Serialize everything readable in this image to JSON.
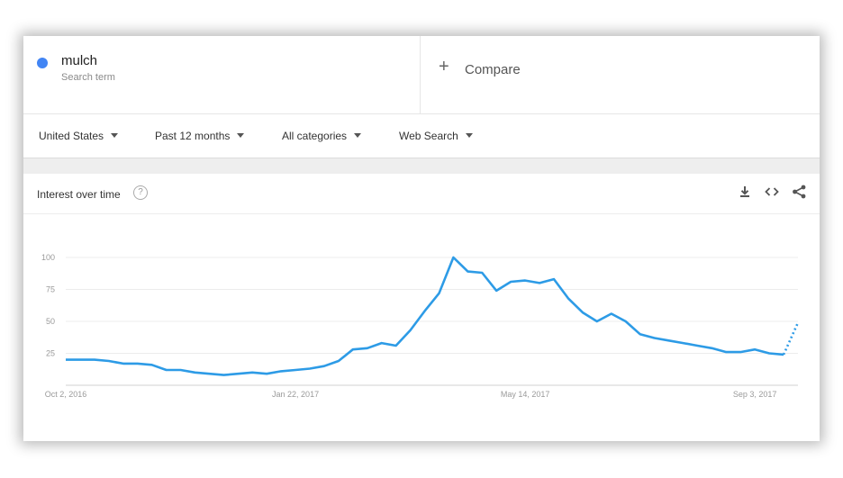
{
  "search_term": {
    "name": "mulch",
    "sublabel": "Search term",
    "color": "#4285f4"
  },
  "compare": {
    "label": "Compare"
  },
  "filters": [
    {
      "label": "United States"
    },
    {
      "label": "Past 12 months"
    },
    {
      "label": "All categories"
    },
    {
      "label": "Web Search"
    }
  ],
  "interest_panel": {
    "title": "Interest over time",
    "icons": [
      "download-icon",
      "embed-icon",
      "share-icon"
    ]
  },
  "chart_data": {
    "type": "line",
    "title": "",
    "xlabel": "",
    "ylabel": "",
    "ylim": [
      0,
      100
    ],
    "yticks": [
      "100",
      "75",
      "50",
      "25"
    ],
    "xticks": [
      "Oct 2, 2016",
      "Jan 22, 2017",
      "May 14, 2017",
      "Sep 3, 2017"
    ],
    "x": [
      "2016-10-02",
      "2016-10-09",
      "2016-10-16",
      "2016-10-23",
      "2016-10-30",
      "2016-11-06",
      "2016-11-13",
      "2016-11-20",
      "2016-11-27",
      "2016-12-04",
      "2016-12-11",
      "2016-12-18",
      "2016-12-25",
      "2017-01-01",
      "2017-01-08",
      "2017-01-15",
      "2017-01-22",
      "2017-01-29",
      "2017-02-05",
      "2017-02-12",
      "2017-02-19",
      "2017-02-26",
      "2017-03-05",
      "2017-03-12",
      "2017-03-19",
      "2017-03-26",
      "2017-04-02",
      "2017-04-09",
      "2017-04-16",
      "2017-04-23",
      "2017-04-30",
      "2017-05-07",
      "2017-05-14",
      "2017-05-21",
      "2017-05-28",
      "2017-06-04",
      "2017-06-11",
      "2017-06-18",
      "2017-06-25",
      "2017-07-02",
      "2017-07-09",
      "2017-07-16",
      "2017-07-23",
      "2017-07-30",
      "2017-08-06",
      "2017-08-13",
      "2017-08-20",
      "2017-08-27",
      "2017-09-03",
      "2017-09-10",
      "2017-09-17",
      "2017-09-24"
    ],
    "series": [
      {
        "color": "#2d9be6",
        "values": [
          20,
          20,
          20,
          19,
          17,
          17,
          16,
          12,
          12,
          10,
          9,
          8,
          9,
          10,
          9,
          11,
          12,
          13,
          15,
          19,
          28,
          29,
          33,
          31,
          43,
          58,
          72,
          100,
          89,
          88,
          74,
          81,
          82,
          80,
          83,
          68,
          57,
          50,
          56,
          50,
          40,
          37,
          35,
          33,
          31,
          29,
          26,
          26,
          28,
          25,
          24,
          49
        ],
        "partial_from_index": 50
      }
    ]
  }
}
